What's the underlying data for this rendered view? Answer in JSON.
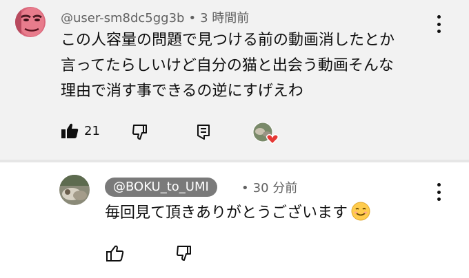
{
  "top_comment": {
    "author": "@user-sm8dc5gg3b",
    "separator": "•",
    "time": "3 時間前",
    "lines": [
      "この人容量の問題で見つける前の動画消したとか",
      "言ってたらしいけど自分の猫と出会う動画そんな",
      "理由で消す事できるの逆にすげえわ"
    ],
    "like_count": "21",
    "icons": {
      "like": "thumbs-up-filled-icon",
      "dislike": "thumbs-down-icon",
      "reply": "reply-comment-icon",
      "creator_heart": "creator-heart-icon",
      "menu": "more-vert-icon"
    }
  },
  "reply_comment": {
    "author": "@BOKU_to_UMI",
    "separator": "•",
    "time": "30 分前",
    "text": "毎回見て頂きありがとうございます",
    "emoji": "☺️",
    "icons": {
      "like": "thumbs-up-icon",
      "dislike": "thumbs-down-icon",
      "menu": "more-vert-icon"
    }
  },
  "colors": {
    "top_background": "#f2f2f2",
    "reply_background": "#ffffff",
    "heart": "#e53935",
    "chip": "#7a7a7a"
  }
}
